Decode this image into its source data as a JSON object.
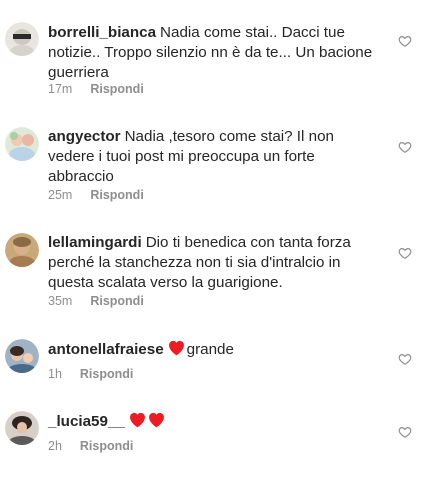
{
  "comments": [
    {
      "username": "borrelli_bianca",
      "text": "Nadia come stai.. Dacci tue notizie.. Troppo silenzio nn è da te... Un bacione guerriera",
      "time": "17m",
      "reply_label": "Rispondi"
    },
    {
      "username": "angyector",
      "text": "Nadia ,tesoro come stai? Il non vedere i tuoi post mi preoccupa un forte abbraccio",
      "time": "25m",
      "reply_label": "Rispondi"
    },
    {
      "username": "lellamingardi",
      "text": "Dio ti benedica con tanta forza perché la stanchezza non ti sia d'intralcio in questa scalata verso la guarigione.",
      "time": "35m",
      "reply_label": "Rispondi"
    },
    {
      "username": "antonellafraiese",
      "text": "grande",
      "time": "1h",
      "reply_label": "Rispondi"
    },
    {
      "username": "_lucia59__",
      "text": "",
      "time": "2h",
      "reply_label": "Rispondi"
    }
  ],
  "colors": {
    "text": "#262626",
    "meta": "#8e8e8e",
    "heart": "#ed1c24"
  },
  "icons": [
    "heart-outline-icon",
    "red-heart-emoji"
  ]
}
